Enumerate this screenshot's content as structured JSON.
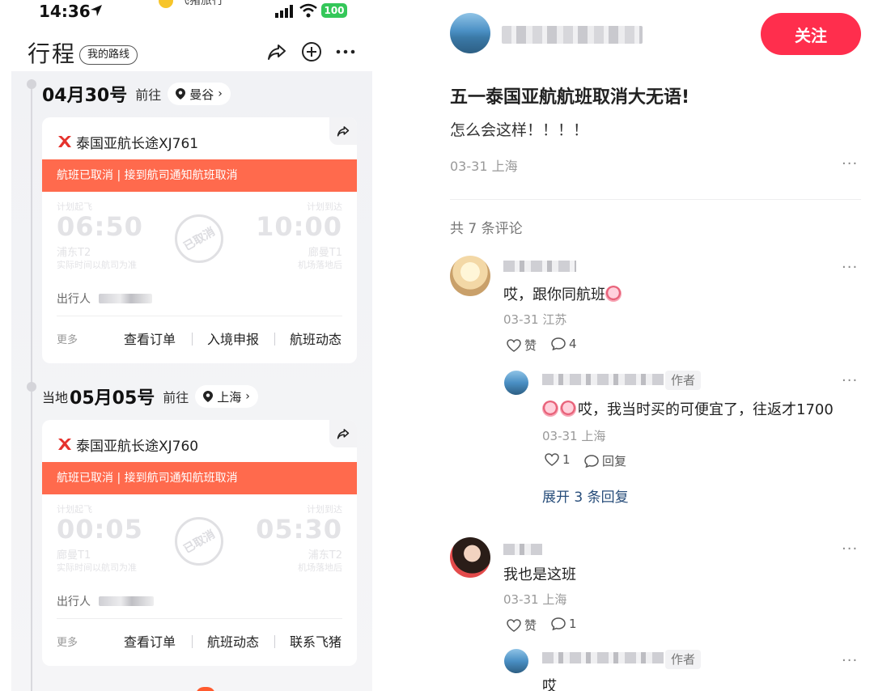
{
  "status_bar": {
    "time": "14:36",
    "center_app": "飞猪旅行",
    "battery": "100"
  },
  "nav": {
    "title": "行程",
    "route_chip": "我的路线"
  },
  "trips": [
    {
      "date": "04月30号",
      "local_prefix": "",
      "dest_prefix": "前往",
      "destination": "曼谷",
      "airline": "泰国亚航长途XJ761",
      "banner": "航班已取消 | 接到航司通知航班取消",
      "dep_label": "计划起飞",
      "dep_time": "06:50",
      "dep_airport": "浦东T2",
      "dep_sub": "实际时间以航司为准",
      "arr_label": "计划到达",
      "arr_time": "10:00",
      "arr_airport": "廊曼T1",
      "arr_sub": "机场落地后",
      "stamp": "已取消",
      "passenger_label": "出行人",
      "more": "更多",
      "actions": [
        "查看订单",
        "入境申报",
        "航班动态"
      ]
    },
    {
      "date": "05月05号",
      "local_prefix": "当地",
      "dest_prefix": "前往",
      "destination": "上海",
      "airline": "泰国亚航长途XJ760",
      "banner": "航班已取消 | 接到航司通知航班取消",
      "dep_label": "计划起飞",
      "dep_time": "00:05",
      "dep_airport": "廊曼T1",
      "dep_sub": "实际时间以航司为准",
      "arr_label": "计划到达",
      "arr_time": "05:30",
      "arr_airport": "浦东T2",
      "arr_sub": "机场落地后",
      "stamp": "已取消",
      "passenger_label": "出行人",
      "more": "更多",
      "actions": [
        "查看订单",
        "航班动态",
        "联系飞猪"
      ]
    }
  ],
  "post": {
    "follow_label": "关注",
    "title": "五一泰国亚航航班取消大无语!",
    "body": "怎么会这样！！！！",
    "meta": "03-31 上海",
    "comment_count": "共 7 条评论",
    "comments": [
      {
        "text": "哎，跟你同航班",
        "meta": "03-31 江苏",
        "likes_label": "赞",
        "replies_count": "4",
        "reply": {
          "author_tag": "作者",
          "text": "哎，我当时买的可便宜了，往返才1700",
          "meta": "03-31 上海",
          "likes": "1",
          "reply_label": "回复"
        },
        "expand": "展开 3 条回复"
      },
      {
        "text": "我也是这班",
        "meta": "03-31 上海",
        "likes_label": "赞",
        "replies_count": "1",
        "reply": {
          "author_tag": "作者",
          "text": "哎"
        }
      }
    ]
  },
  "colors": {
    "accent": "#ff2e4d",
    "cancel_banner": "#ff6a4d",
    "link": "#274d7a"
  }
}
